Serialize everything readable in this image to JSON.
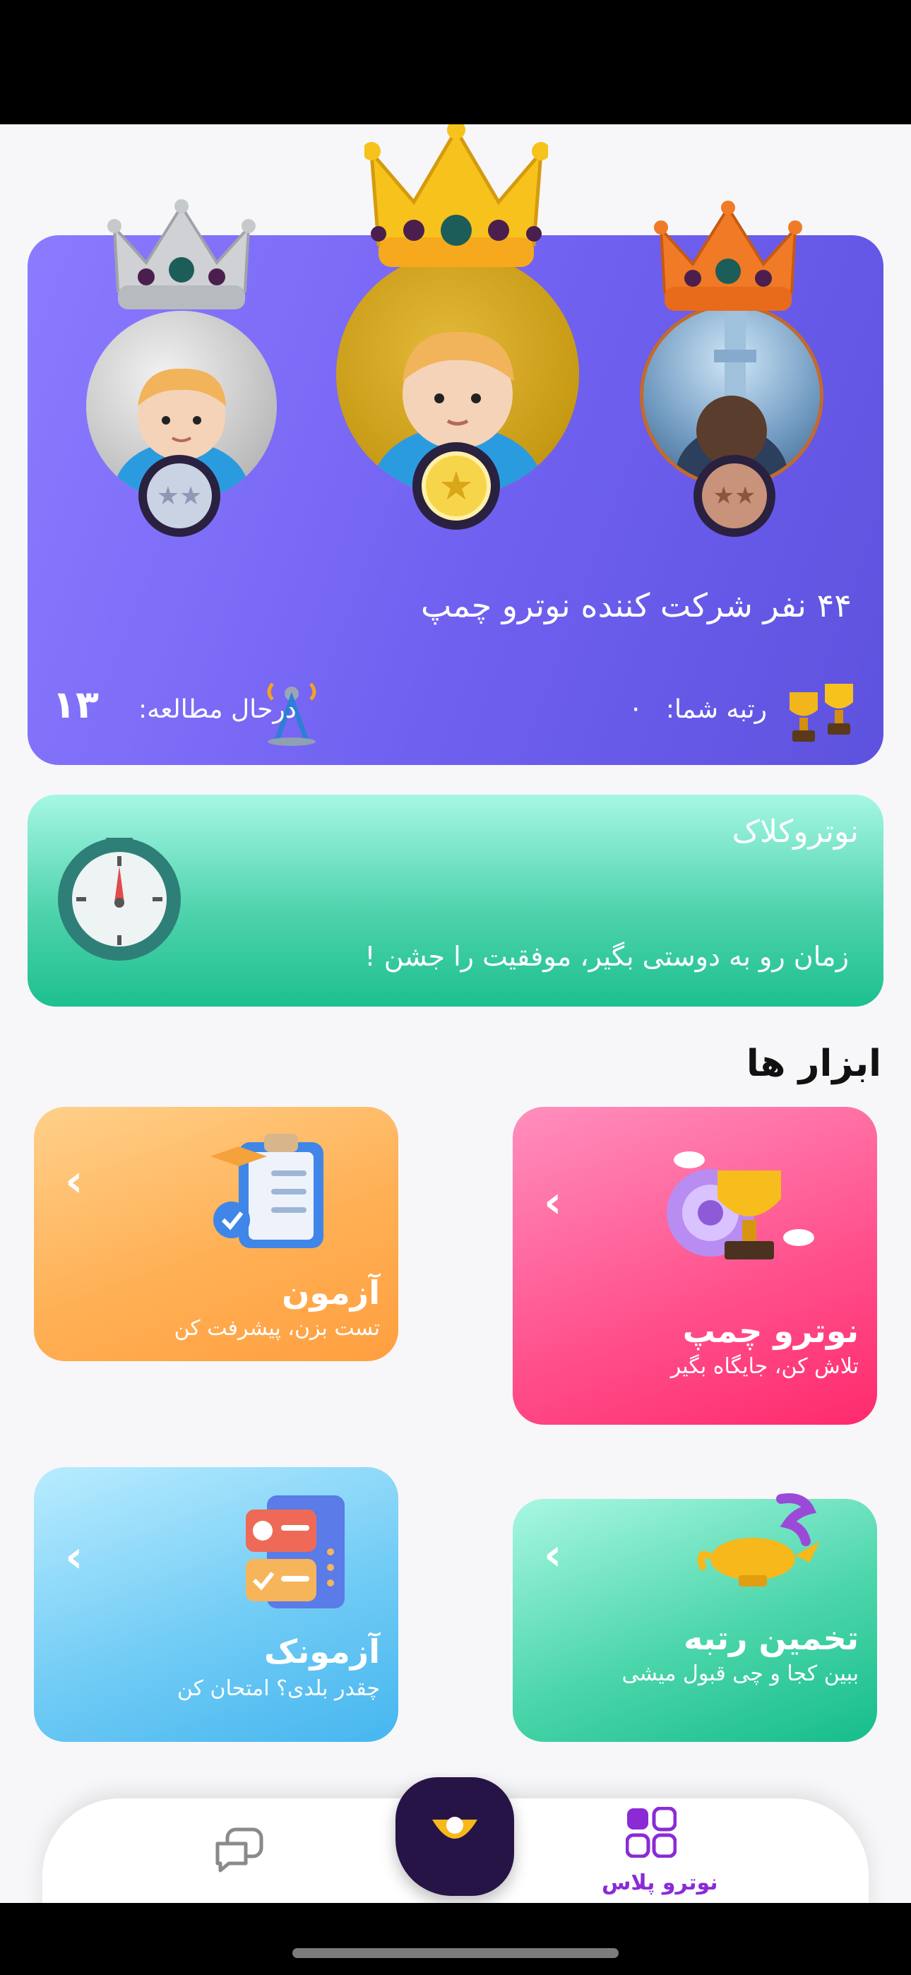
{
  "leaderboard": {
    "title": "۴۴ نفر شرکت کننده نوترو چمپ",
    "rank_label": "رتبه شما:",
    "rank_value": "۰",
    "studying_label": "درحال مطالعه:",
    "studying_value": "۱۳"
  },
  "clock_card": {
    "title": "نوتروکلاک",
    "subtitle": "زمان رو به دوستی بگیر، موفقیت را جشن !"
  },
  "tools": {
    "heading": "ابزار ها",
    "items": [
      {
        "title": "نوترو چمپ",
        "subtitle": "تلاش کن، جایگاه بگیر"
      },
      {
        "title": "آزمون",
        "subtitle": "تست بزن، پیشرفت کن"
      },
      {
        "title": "تخمین رتبه",
        "subtitle": "ببین کجا و چی قبول میشی"
      },
      {
        "title": "آزمونک",
        "subtitle": "چقدر بلدی؟ امتحان کن"
      }
    ]
  },
  "bottom_nav": {
    "active_label": "نوترو پلاس"
  },
  "colors": {
    "leader_gradient": "#7060f0",
    "clock_gradient": "#1dc08f",
    "champ": "#ff2a6d",
    "exam": "#ff9f3f",
    "rank": "#16bd8a",
    "quiz": "#46b6ef",
    "nav_active": "#8a2bd6",
    "fab": "#261447"
  }
}
